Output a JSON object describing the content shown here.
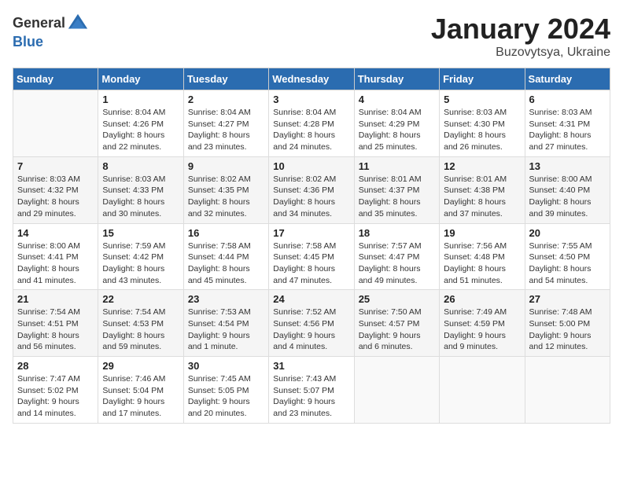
{
  "header": {
    "logo_general": "General",
    "logo_blue": "Blue",
    "month_year": "January 2024",
    "location": "Buzovytsya, Ukraine"
  },
  "weekdays": [
    "Sunday",
    "Monday",
    "Tuesday",
    "Wednesday",
    "Thursday",
    "Friday",
    "Saturday"
  ],
  "weeks": [
    [
      {
        "day": "",
        "info": ""
      },
      {
        "day": "1",
        "info": "Sunrise: 8:04 AM\nSunset: 4:26 PM\nDaylight: 8 hours\nand 22 minutes."
      },
      {
        "day": "2",
        "info": "Sunrise: 8:04 AM\nSunset: 4:27 PM\nDaylight: 8 hours\nand 23 minutes."
      },
      {
        "day": "3",
        "info": "Sunrise: 8:04 AM\nSunset: 4:28 PM\nDaylight: 8 hours\nand 24 minutes."
      },
      {
        "day": "4",
        "info": "Sunrise: 8:04 AM\nSunset: 4:29 PM\nDaylight: 8 hours\nand 25 minutes."
      },
      {
        "day": "5",
        "info": "Sunrise: 8:03 AM\nSunset: 4:30 PM\nDaylight: 8 hours\nand 26 minutes."
      },
      {
        "day": "6",
        "info": "Sunrise: 8:03 AM\nSunset: 4:31 PM\nDaylight: 8 hours\nand 27 minutes."
      }
    ],
    [
      {
        "day": "7",
        "info": "Sunrise: 8:03 AM\nSunset: 4:32 PM\nDaylight: 8 hours\nand 29 minutes."
      },
      {
        "day": "8",
        "info": "Sunrise: 8:03 AM\nSunset: 4:33 PM\nDaylight: 8 hours\nand 30 minutes."
      },
      {
        "day": "9",
        "info": "Sunrise: 8:02 AM\nSunset: 4:35 PM\nDaylight: 8 hours\nand 32 minutes."
      },
      {
        "day": "10",
        "info": "Sunrise: 8:02 AM\nSunset: 4:36 PM\nDaylight: 8 hours\nand 34 minutes."
      },
      {
        "day": "11",
        "info": "Sunrise: 8:01 AM\nSunset: 4:37 PM\nDaylight: 8 hours\nand 35 minutes."
      },
      {
        "day": "12",
        "info": "Sunrise: 8:01 AM\nSunset: 4:38 PM\nDaylight: 8 hours\nand 37 minutes."
      },
      {
        "day": "13",
        "info": "Sunrise: 8:00 AM\nSunset: 4:40 PM\nDaylight: 8 hours\nand 39 minutes."
      }
    ],
    [
      {
        "day": "14",
        "info": "Sunrise: 8:00 AM\nSunset: 4:41 PM\nDaylight: 8 hours\nand 41 minutes."
      },
      {
        "day": "15",
        "info": "Sunrise: 7:59 AM\nSunset: 4:42 PM\nDaylight: 8 hours\nand 43 minutes."
      },
      {
        "day": "16",
        "info": "Sunrise: 7:58 AM\nSunset: 4:44 PM\nDaylight: 8 hours\nand 45 minutes."
      },
      {
        "day": "17",
        "info": "Sunrise: 7:58 AM\nSunset: 4:45 PM\nDaylight: 8 hours\nand 47 minutes."
      },
      {
        "day": "18",
        "info": "Sunrise: 7:57 AM\nSunset: 4:47 PM\nDaylight: 8 hours\nand 49 minutes."
      },
      {
        "day": "19",
        "info": "Sunrise: 7:56 AM\nSunset: 4:48 PM\nDaylight: 8 hours\nand 51 minutes."
      },
      {
        "day": "20",
        "info": "Sunrise: 7:55 AM\nSunset: 4:50 PM\nDaylight: 8 hours\nand 54 minutes."
      }
    ],
    [
      {
        "day": "21",
        "info": "Sunrise: 7:54 AM\nSunset: 4:51 PM\nDaylight: 8 hours\nand 56 minutes."
      },
      {
        "day": "22",
        "info": "Sunrise: 7:54 AM\nSunset: 4:53 PM\nDaylight: 8 hours\nand 59 minutes."
      },
      {
        "day": "23",
        "info": "Sunrise: 7:53 AM\nSunset: 4:54 PM\nDaylight: 9 hours\nand 1 minute."
      },
      {
        "day": "24",
        "info": "Sunrise: 7:52 AM\nSunset: 4:56 PM\nDaylight: 9 hours\nand 4 minutes."
      },
      {
        "day": "25",
        "info": "Sunrise: 7:50 AM\nSunset: 4:57 PM\nDaylight: 9 hours\nand 6 minutes."
      },
      {
        "day": "26",
        "info": "Sunrise: 7:49 AM\nSunset: 4:59 PM\nDaylight: 9 hours\nand 9 minutes."
      },
      {
        "day": "27",
        "info": "Sunrise: 7:48 AM\nSunset: 5:00 PM\nDaylight: 9 hours\nand 12 minutes."
      }
    ],
    [
      {
        "day": "28",
        "info": "Sunrise: 7:47 AM\nSunset: 5:02 PM\nDaylight: 9 hours\nand 14 minutes."
      },
      {
        "day": "29",
        "info": "Sunrise: 7:46 AM\nSunset: 5:04 PM\nDaylight: 9 hours\nand 17 minutes."
      },
      {
        "day": "30",
        "info": "Sunrise: 7:45 AM\nSunset: 5:05 PM\nDaylight: 9 hours\nand 20 minutes."
      },
      {
        "day": "31",
        "info": "Sunrise: 7:43 AM\nSunset: 5:07 PM\nDaylight: 9 hours\nand 23 minutes."
      },
      {
        "day": "",
        "info": ""
      },
      {
        "day": "",
        "info": ""
      },
      {
        "day": "",
        "info": ""
      }
    ]
  ]
}
